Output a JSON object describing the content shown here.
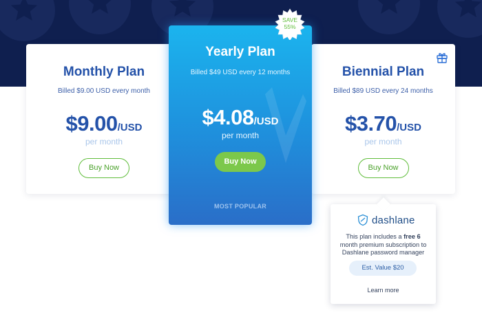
{
  "plans": {
    "monthly": {
      "title": "Monthly Plan",
      "billed": "Billed $9.00 USD every month",
      "price": "$9.00",
      "unit": "/USD",
      "per": "per month",
      "button": "Buy Now"
    },
    "yearly": {
      "title": "Yearly Plan",
      "billed": "Billed $49 USD every 12 months",
      "price": "$4.08",
      "unit": "/USD",
      "per": "per month",
      "button": "Buy Now",
      "tag": "MOST POPULAR",
      "badge_line1": "SAVE",
      "badge_line2": "55%"
    },
    "biennial": {
      "title": "Biennial Plan",
      "billed": "Billed $89 USD every 24 months",
      "price": "$3.70",
      "unit": "/USD",
      "per": "per month",
      "button": "Buy Now"
    }
  },
  "popover": {
    "brand": "dashlane",
    "desc_pre": "This plan includes a ",
    "desc_bold": "free 6",
    "desc_post": "month premium subscription to Dashlane password manager",
    "est_value": "Est. Value $20",
    "learn_more": "Learn more"
  },
  "icons": {
    "gift": "gift-icon",
    "dashlane": "dashlane-shield-icon",
    "star": "star-icon"
  },
  "colors": {
    "hero_band": "#0f1f4f",
    "plan_blue": "#2452a9",
    "accent_green": "#5fbd3a",
    "yearly_gradient_top": "#1bb4ee",
    "yearly_gradient_bottom": "#2a6ec8"
  }
}
